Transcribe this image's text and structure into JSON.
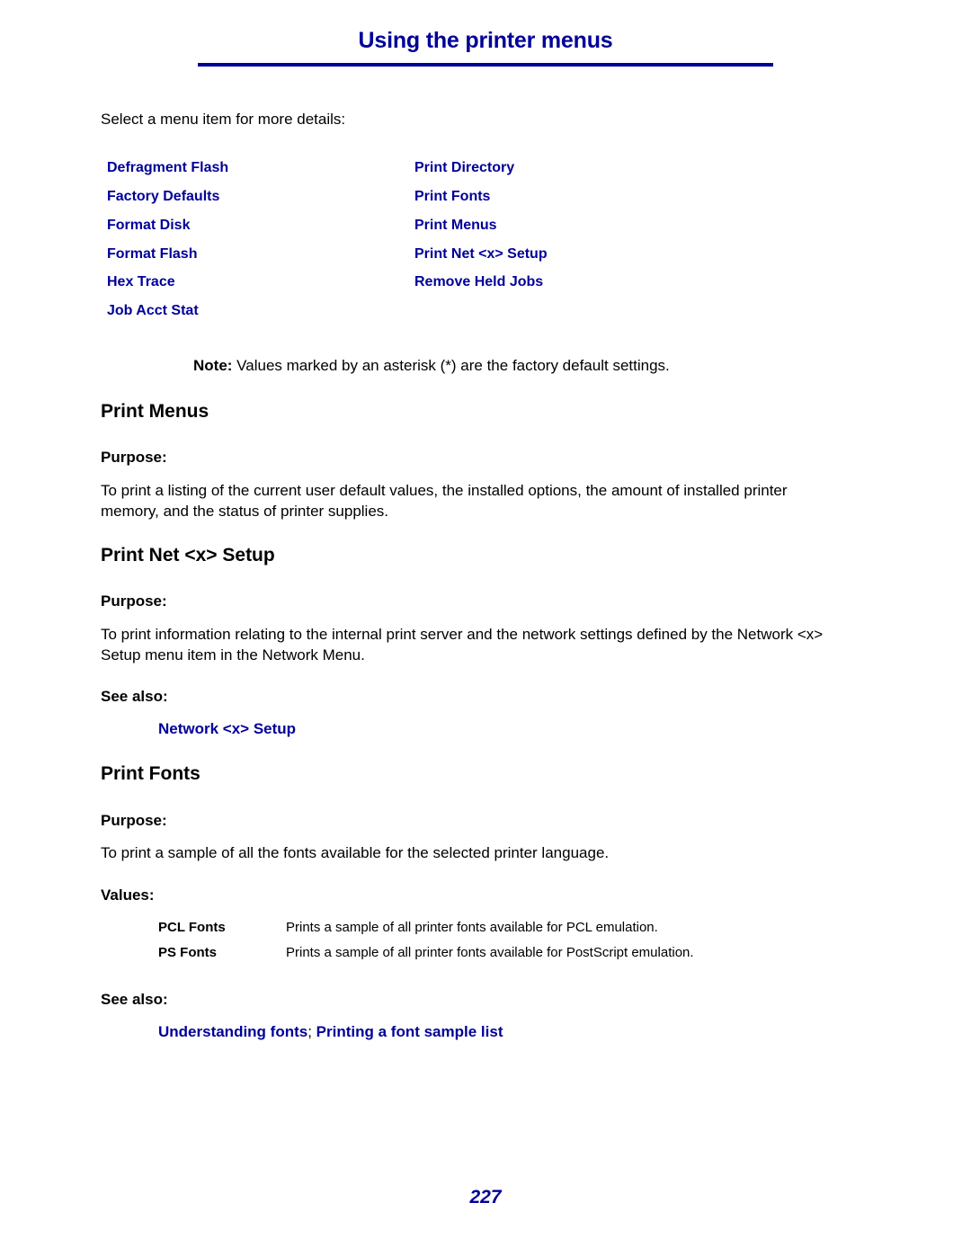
{
  "header": {
    "title": "Using the printer menus",
    "accent_color": "#000099"
  },
  "intro": "Select a menu item for more details:",
  "menu_items": {
    "left": [
      "Defragment Flash",
      "Factory Defaults",
      "Format Disk",
      "Format Flash",
      "Hex Trace",
      "Job Acct Stat"
    ],
    "right": [
      "Print Directory",
      "Print Fonts",
      "Print Menus",
      "Print Net <x> Setup",
      "Remove Held Jobs"
    ]
  },
  "note": {
    "label": "Note:",
    "text": " Values marked by an asterisk (*) are the factory default settings."
  },
  "sections": {
    "print_menus": {
      "heading": "Print Menus",
      "purpose_label": "Purpose:",
      "purpose_text": "To print a listing of the current user default values, the installed options, the amount of installed printer memory, and the status of printer supplies."
    },
    "print_net_setup": {
      "heading": "Print Net <x> Setup",
      "purpose_label": "Purpose:",
      "purpose_text": "To print information relating to the internal print server and the network settings defined by the Network <x> Setup menu item in the Network Menu.",
      "see_also_label": "See also:",
      "see_also_links": [
        "Network <x> Setup"
      ]
    },
    "print_fonts": {
      "heading": "Print Fonts",
      "purpose_label": "Purpose:",
      "purpose_text": "To print a sample of all the fonts available for the selected printer language.",
      "values_label": "Values:",
      "values": [
        {
          "name": "PCL Fonts",
          "description": "Prints a sample of all printer fonts available for PCL emulation."
        },
        {
          "name": "PS Fonts",
          "description": "Prints a sample of all printer fonts available for PostScript emulation."
        }
      ],
      "see_also_label": "See also:",
      "see_also_links": [
        "Understanding fonts",
        "Printing a font sample list"
      ],
      "see_also_separator": "; "
    }
  },
  "page_number": "227"
}
